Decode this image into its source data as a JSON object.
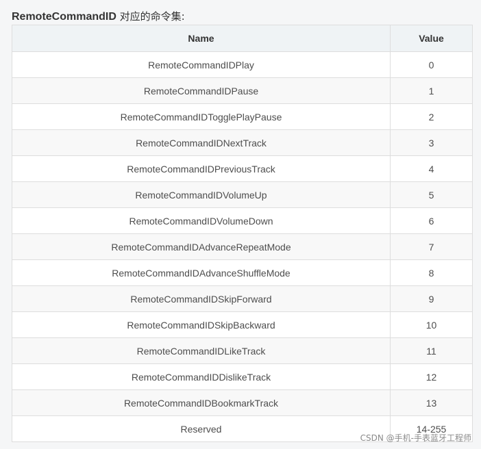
{
  "heading": {
    "bold_text": "RemoteCommandID",
    "rest_text": " 对应的命令集:"
  },
  "table": {
    "headers": {
      "name": "Name",
      "value": "Value"
    },
    "rows": [
      {
        "name": "RemoteCommandIDPlay",
        "value": "0"
      },
      {
        "name": "RemoteCommandIDPause",
        "value": "1"
      },
      {
        "name": "RemoteCommandIDTogglePlayPause",
        "value": "2"
      },
      {
        "name": "RemoteCommandIDNextTrack",
        "value": "3"
      },
      {
        "name": "RemoteCommandIDPreviousTrack",
        "value": "4"
      },
      {
        "name": "RemoteCommandIDVolumeUp",
        "value": "5"
      },
      {
        "name": "RemoteCommandIDVolumeDown",
        "value": "6"
      },
      {
        "name": "RemoteCommandIDAdvanceRepeatMode",
        "value": "7"
      },
      {
        "name": "RemoteCommandIDAdvanceShuffleMode",
        "value": "8"
      },
      {
        "name": "RemoteCommandIDSkipForward",
        "value": "9"
      },
      {
        "name": "RemoteCommandIDSkipBackward",
        "value": "10"
      },
      {
        "name": "RemoteCommandIDLikeTrack",
        "value": "11"
      },
      {
        "name": "RemoteCommandIDDislikeTrack",
        "value": "12"
      },
      {
        "name": "RemoteCommandIDBookmarkTrack",
        "value": "13"
      },
      {
        "name": "Reserved",
        "value": "14-255"
      }
    ]
  },
  "watermark": "CSDN @手机-手表蓝牙工程师"
}
